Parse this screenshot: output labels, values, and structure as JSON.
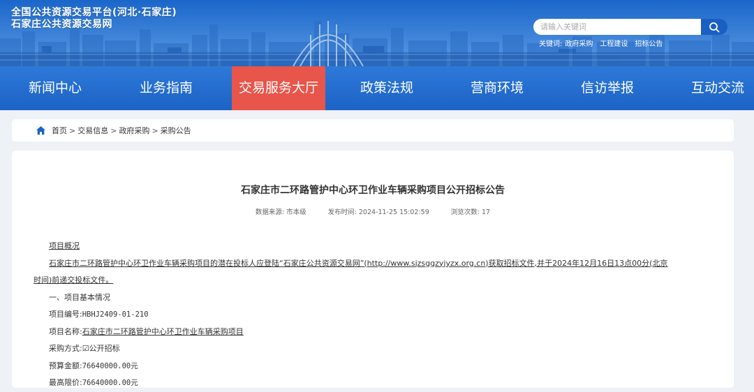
{
  "header": {
    "title_line1": "全国公共资源交易平台(河北·石家庄)",
    "title_line2": "石家庄公共资源交易网",
    "search_placeholder": "请输入关键词",
    "keywords_label": "关键词:",
    "keywords": [
      "政府采购",
      "工程建设",
      "招标公告"
    ]
  },
  "nav": {
    "items": [
      "新闻中心",
      "业务指南",
      "交易服务大厅",
      "政策法规",
      "营商环境",
      "信访举报",
      "互动交流"
    ],
    "active_index": 2
  },
  "breadcrumb": [
    "首页",
    "交易信息",
    "政府采购",
    "采购公告"
  ],
  "article": {
    "title": "石家庄市二环路管护中心环卫作业车辆采购项目公开招标公告",
    "source": "数据来源:  市本级",
    "published": "发布时间:  2024-11-25 15:02:59",
    "views": "浏览次数:  17",
    "section_overview": "项目概况",
    "overview_line1": "石家庄市二环路管护中心环卫作业车辆采购项目的潜在投标人应登陆“石家庄公共资源交易网”(http://www.sjzsggzyjyzx.org.cn)获取招标文件,并于2024年12月16日13点00分(北京",
    "overview_line2": "时间)前递交投标文件。",
    "section_basic": "一、项目基本情况",
    "project_no_label": "项目编号:",
    "project_no": "HBHJ2409-01-210",
    "project_name_label": "项目名称:",
    "project_name": "石家庄市二环路管护中心环卫作业车辆采购项目",
    "method_label": "采购方式:",
    "method": "☑公开招标",
    "budget_label": "预算金额:",
    "budget": "76640000.00元",
    "limit_label": "最高限价:",
    "limit": "76640000.00元"
  },
  "colors": {
    "nav_bg": "#1c63c6",
    "nav_active": "#e8554a",
    "search_btn": "#1a5fc2"
  }
}
